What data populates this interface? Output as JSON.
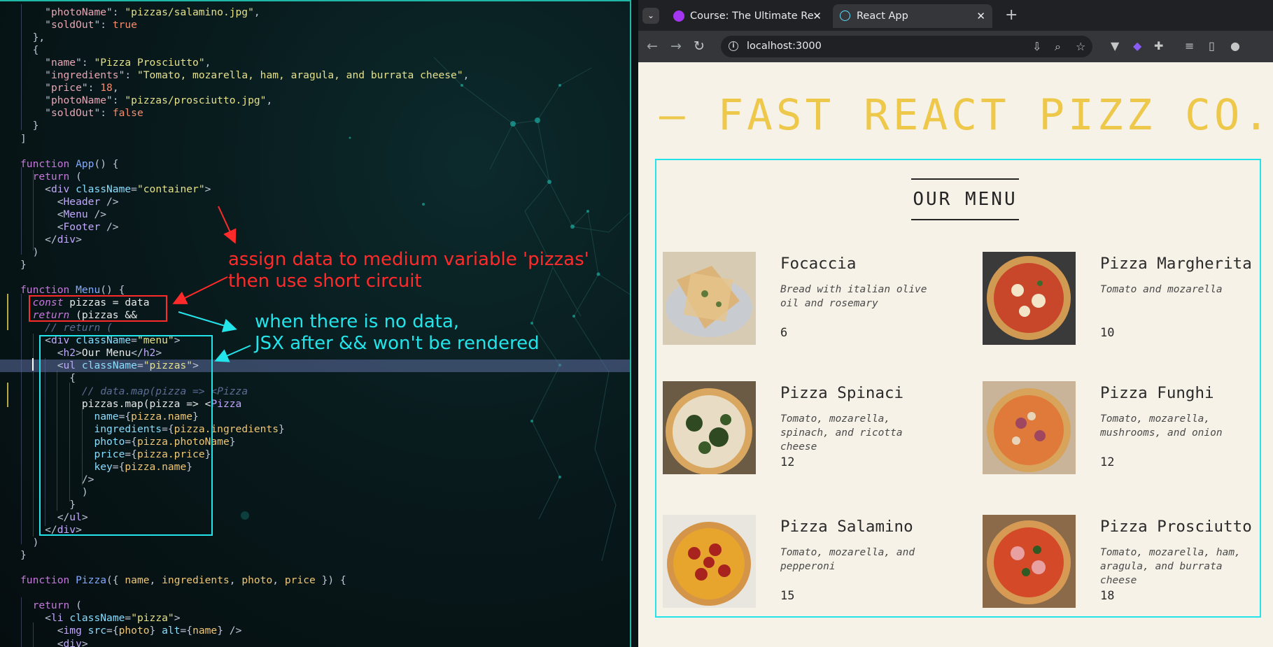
{
  "editor": {
    "lines": [
      [
        [
          "pun",
          "    \""
        ],
        [
          "p",
          "photoName"
        ],
        [
          "pun",
          "\": "
        ],
        [
          "s",
          "\"pizzas/salamino.jpg\""
        ],
        [
          "pun",
          ","
        ]
      ],
      [
        [
          "pun",
          "    \""
        ],
        [
          "p",
          "soldOut"
        ],
        [
          "pun",
          "\": "
        ],
        [
          "n",
          "true"
        ]
      ],
      [
        [
          "pun",
          "  },"
        ]
      ],
      [
        [
          "pun",
          "  {"
        ]
      ],
      [
        [
          "pun",
          "    \""
        ],
        [
          "p",
          "name"
        ],
        [
          "pun",
          "\": "
        ],
        [
          "s",
          "\"Pizza Prosciutto\""
        ],
        [
          "pun",
          ","
        ]
      ],
      [
        [
          "pun",
          "    \""
        ],
        [
          "p",
          "ingredients"
        ],
        [
          "pun",
          "\": "
        ],
        [
          "s",
          "\"Tomato, mozarella, ham, aragula, and burrata cheese\""
        ],
        [
          "pun",
          ","
        ]
      ],
      [
        [
          "pun",
          "    \""
        ],
        [
          "p",
          "price"
        ],
        [
          "pun",
          "\": "
        ],
        [
          "n",
          "18"
        ],
        [
          "pun",
          ","
        ]
      ],
      [
        [
          "pun",
          "    \""
        ],
        [
          "p",
          "photoName"
        ],
        [
          "pun",
          "\": "
        ],
        [
          "s",
          "\"pizzas/prosciutto.jpg\""
        ],
        [
          "pun",
          ","
        ]
      ],
      [
        [
          "pun",
          "    \""
        ],
        [
          "p",
          "soldOut"
        ],
        [
          "pun",
          "\": "
        ],
        [
          "n",
          "false"
        ]
      ],
      [
        [
          "pun",
          "  }"
        ]
      ],
      [
        [
          "pun",
          "]"
        ]
      ],
      [],
      [
        [
          "k",
          "function"
        ],
        [
          "pun",
          " "
        ],
        [
          "f",
          "App"
        ],
        [
          "pun",
          "() {"
        ]
      ],
      [
        [
          "pun",
          "  "
        ],
        [
          "k",
          "return"
        ],
        [
          "pun",
          " ("
        ]
      ],
      [
        [
          "pun",
          "    <"
        ],
        [
          "t",
          "div"
        ],
        [
          "pun",
          " "
        ],
        [
          "a",
          "className"
        ],
        [
          "pun",
          "="
        ],
        [
          "s",
          "\"container\""
        ],
        [
          "pun",
          ">"
        ]
      ],
      [
        [
          "pun",
          "      <"
        ],
        [
          "t",
          "Header"
        ],
        [
          "pun",
          " />"
        ]
      ],
      [
        [
          "pun",
          "      <"
        ],
        [
          "t",
          "Menu"
        ],
        [
          "pun",
          " />"
        ]
      ],
      [
        [
          "pun",
          "      <"
        ],
        [
          "t",
          "Footer"
        ],
        [
          "pun",
          " />"
        ]
      ],
      [
        [
          "pun",
          "    </"
        ],
        [
          "t",
          "div"
        ],
        [
          "pun",
          ">"
        ]
      ],
      [
        [
          "pun",
          "  )"
        ]
      ],
      [
        [
          "pun",
          "}"
        ]
      ],
      [],
      [
        [
          "k",
          "function"
        ],
        [
          "pun",
          " "
        ],
        [
          "f",
          "Menu"
        ],
        [
          "pun",
          "() {"
        ]
      ],
      [
        [
          "pun",
          "  "
        ],
        [
          "k it",
          "const"
        ],
        [
          "pr",
          " pizzas = data"
        ]
      ],
      [
        [
          "pun",
          "  "
        ],
        [
          "k it",
          "return"
        ],
        [
          "pr",
          " (pizzas &&"
        ]
      ],
      [
        [
          "pun",
          "    "
        ],
        [
          "c",
          "// return ("
        ]
      ],
      [
        [
          "pun",
          "    <"
        ],
        [
          "t",
          "div"
        ],
        [
          "pun",
          " "
        ],
        [
          "a",
          "className"
        ],
        [
          "pun",
          "="
        ],
        [
          "s",
          "\"menu\""
        ],
        [
          "pun",
          ">"
        ]
      ],
      [
        [
          "pun",
          "      <"
        ],
        [
          "t",
          "h2"
        ],
        [
          "pun",
          ">"
        ],
        [
          "pr",
          "Our Menu"
        ],
        [
          "pun",
          "</"
        ],
        [
          "t",
          "h2"
        ],
        [
          "pun",
          ">"
        ]
      ],
      [
        [
          "pun",
          "      <"
        ],
        [
          "t",
          "ul"
        ],
        [
          "pun",
          " "
        ],
        [
          "a",
          "className"
        ],
        [
          "pun",
          "="
        ],
        [
          "s",
          "\"pizzas\""
        ],
        [
          "pun",
          ">"
        ]
      ],
      [
        [
          "pun",
          "        {"
        ]
      ],
      [
        [
          "pun",
          "          "
        ],
        [
          "c",
          "// data.map(pizza => <Pizza"
        ]
      ],
      [
        [
          "pun",
          "          "
        ],
        [
          "pr",
          "pizzas.map(pizza => <"
        ],
        [
          "t",
          "Pizza"
        ]
      ],
      [
        [
          "pun",
          "            "
        ],
        [
          "a",
          "name"
        ],
        [
          "pun",
          "={"
        ],
        [
          "v",
          "pizza.name"
        ],
        [
          "pun",
          "}"
        ]
      ],
      [
        [
          "pun",
          "            "
        ],
        [
          "a",
          "ingredients"
        ],
        [
          "pun",
          "={"
        ],
        [
          "v",
          "pizza.ingredients"
        ],
        [
          "pun",
          "}"
        ]
      ],
      [
        [
          "pun",
          "            "
        ],
        [
          "a",
          "photo"
        ],
        [
          "pun",
          "={"
        ],
        [
          "v",
          "pizza.photoName"
        ],
        [
          "pun",
          "}"
        ]
      ],
      [
        [
          "pun",
          "            "
        ],
        [
          "a",
          "price"
        ],
        [
          "pun",
          "={"
        ],
        [
          "v",
          "pizza.price"
        ],
        [
          "pun",
          "}"
        ]
      ],
      [
        [
          "pun",
          "            "
        ],
        [
          "a",
          "key"
        ],
        [
          "pun",
          "={"
        ],
        [
          "v",
          "pizza.name"
        ],
        [
          "pun",
          "}"
        ]
      ],
      [
        [
          "pun",
          "          />"
        ]
      ],
      [
        [
          "pun",
          "          )"
        ]
      ],
      [
        [
          "pun",
          "        }"
        ]
      ],
      [
        [
          "pun",
          "      </"
        ],
        [
          "t",
          "ul"
        ],
        [
          "pun",
          ">"
        ]
      ],
      [
        [
          "pun",
          "    </"
        ],
        [
          "t",
          "div"
        ],
        [
          "pun",
          ">"
        ]
      ],
      [
        [
          "pun",
          "  )"
        ]
      ],
      [
        [
          "pun",
          "}"
        ]
      ],
      [],
      [
        [
          "k",
          "function"
        ],
        [
          "pun",
          " "
        ],
        [
          "f",
          "Pizza"
        ],
        [
          "pun",
          "({ "
        ],
        [
          "v",
          "name"
        ],
        [
          "pun",
          ", "
        ],
        [
          "v",
          "ingredients"
        ],
        [
          "pun",
          ", "
        ],
        [
          "v",
          "photo"
        ],
        [
          "pun",
          ", "
        ],
        [
          "v",
          "price"
        ],
        [
          "pun",
          " }) {"
        ]
      ],
      [],
      [
        [
          "pun",
          "  "
        ],
        [
          "k",
          "return"
        ],
        [
          "pun",
          " ("
        ]
      ],
      [
        [
          "pun",
          "    <"
        ],
        [
          "t",
          "li"
        ],
        [
          "pun",
          " "
        ],
        [
          "a",
          "className"
        ],
        [
          "pun",
          "="
        ],
        [
          "s",
          "\"pizza\""
        ],
        [
          "pun",
          ">"
        ]
      ],
      [
        [
          "pun",
          "      <"
        ],
        [
          "t",
          "img"
        ],
        [
          "pun",
          " "
        ],
        [
          "a",
          "src"
        ],
        [
          "pun",
          "={"
        ],
        [
          "v",
          "photo"
        ],
        [
          "pun",
          "} "
        ],
        [
          "a",
          "alt"
        ],
        [
          "pun",
          "={"
        ],
        [
          "v",
          "name"
        ],
        [
          "pun",
          "} />"
        ]
      ],
      [
        [
          "pun",
          "      <"
        ],
        [
          "t",
          "div"
        ],
        [
          "pun",
          ">"
        ]
      ]
    ],
    "annotations": {
      "red_note": "assign data to medium variable 'pizzas'\nthen use short circuit",
      "cyan_note": "when there is no data,\nJSX after && won't be rendered"
    },
    "colors": {
      "red": "#ff2a2a",
      "cyan": "#22e4ea",
      "accent": "#1fb8a6"
    }
  },
  "browser": {
    "tabs": [
      {
        "title": "Course: The Ultimate Re",
        "active": false,
        "icon": "udemy-icon"
      },
      {
        "title": "React App",
        "active": true,
        "icon": "react-icon"
      }
    ],
    "new_tab": "+",
    "url": "localhost:3000",
    "page": {
      "brand": "— FAST REACT PIZZ CO. —",
      "menu_title": "OUR MENU",
      "pizzas": [
        {
          "name": "Focaccia",
          "ingredients": "Bread with italian olive oil and rosemary",
          "price": "6"
        },
        {
          "name": "Pizza Margherita",
          "ingredients": "Tomato and mozarella",
          "price": "10"
        },
        {
          "name": "Pizza Spinaci",
          "ingredients": "Tomato, mozarella, spinach, and ricotta cheese",
          "price": "12"
        },
        {
          "name": "Pizza Funghi",
          "ingredients": "Tomato, mozarella, mushrooms, and onion",
          "price": "12"
        },
        {
          "name": "Pizza Salamino",
          "ingredients": "Tomato, mozarella, and pepperoni",
          "price": "15"
        },
        {
          "name": "Pizza Prosciutto",
          "ingredients": "Tomato, mozarella, ham, aragula, and burrata cheese",
          "price": "18"
        }
      ],
      "colors": {
        "brand": "#edc84b",
        "frame": "#22e2ea",
        "background": "#f7f2e8"
      }
    }
  }
}
